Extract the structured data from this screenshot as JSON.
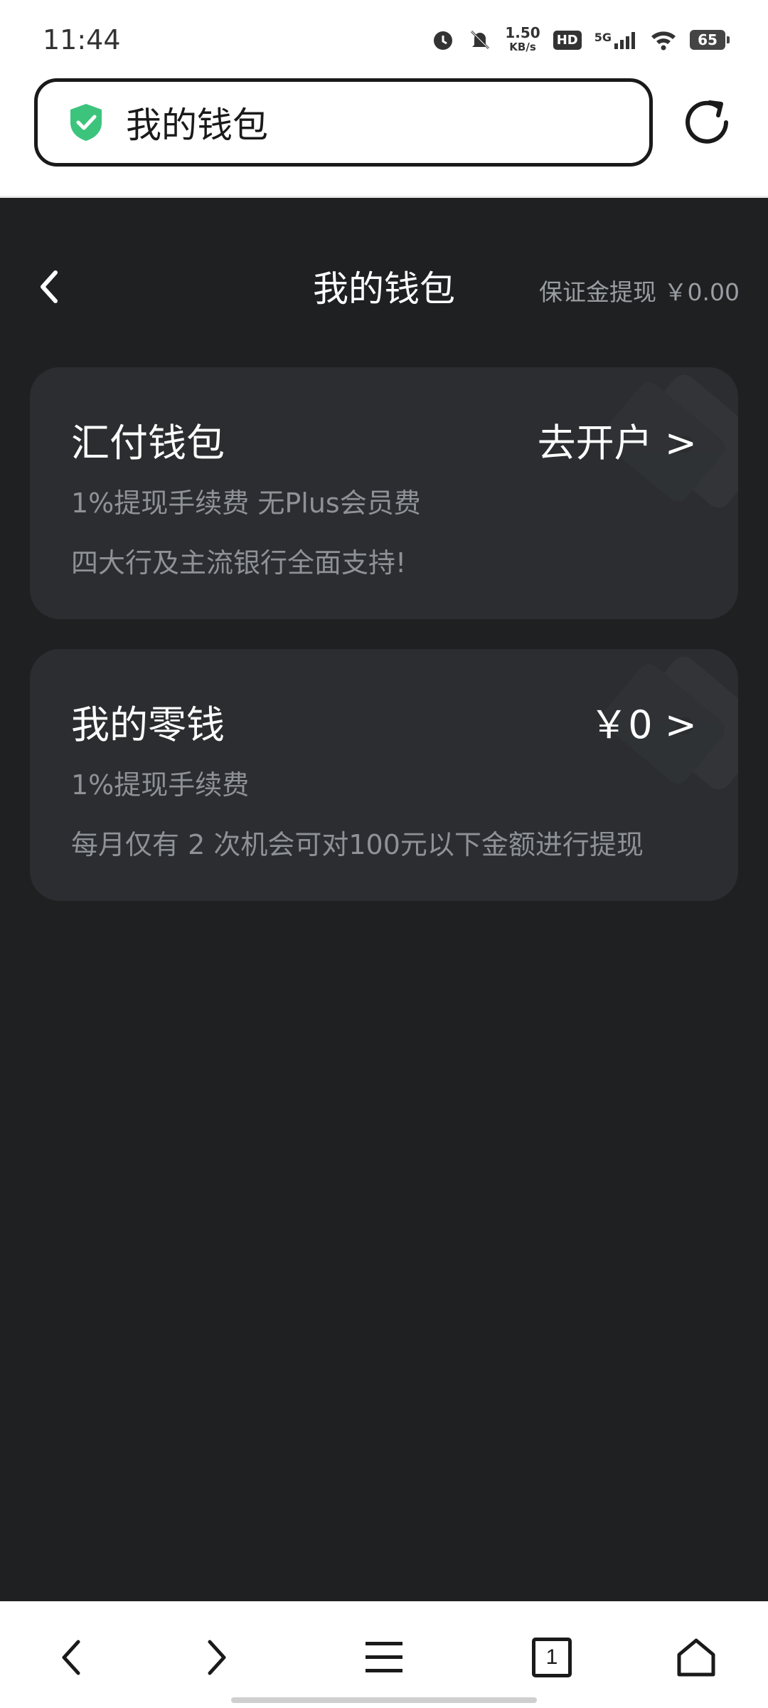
{
  "status_bar": {
    "time": "11:44",
    "net_speed_value": "1.50",
    "net_speed_unit": "KB/s",
    "hd_label": "HD",
    "network_label": "5G",
    "battery_level": "65",
    "icons": [
      "alarm-icon",
      "mute-icon",
      "hd-icon",
      "signal-icon",
      "wifi-icon",
      "battery-icon"
    ]
  },
  "browser": {
    "url_title": "我的钱包",
    "secure_icon": "shield-check-icon",
    "reload_icon": "reload-icon",
    "accent_color": "#3cc47c"
  },
  "page": {
    "title": "我的钱包",
    "deposit_withdraw": "保证金提现 ￥0.00",
    "cards": [
      {
        "title": "汇付钱包",
        "action": "去开户 >",
        "line1": "1%提现手续费 无Plus会员费",
        "line2": "四大行及主流银行全面支持!"
      },
      {
        "title": "我的零钱",
        "action": "￥0 >",
        "line1": "1%提现手续费",
        "line2": "每月仅有 2 次机会可对100元以下金额进行提现"
      }
    ]
  },
  "nav": {
    "tabs_count": "1",
    "icons": [
      "back-icon",
      "forward-icon",
      "menu-icon",
      "tabs-icon",
      "home-icon"
    ]
  }
}
